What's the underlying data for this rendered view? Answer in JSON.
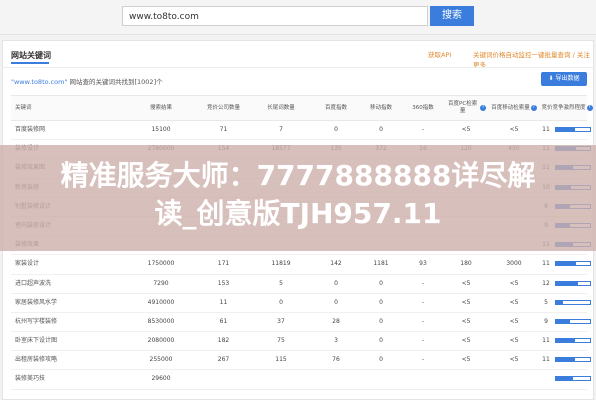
{
  "search": {
    "query": "www.to8to.com",
    "button": "搜索"
  },
  "card": {
    "title": "网站关键词",
    "link_api": "获取API",
    "link_promo": "关键词价格自动监控一键批量查询 / 关注更多",
    "summary_prefix": "\"www.to8to.com\"",
    "summary_rest": " 网站查的关键词共找到[1002]个",
    "export": "导出数据"
  },
  "headers": [
    "关键词",
    "搜索结果",
    "竞价公司数量",
    "长尾词数量",
    "百度指数",
    "移动指数",
    "360指数",
    "百度PC检索量",
    "百度移动检索量",
    "竞价竞争激烈程度"
  ],
  "rows": [
    {
      "kw": "百度装修网",
      "c2": "15100",
      "c3": "71",
      "c4": "7",
      "c5": "0",
      "c6": "0",
      "c7": "-",
      "c8": "<5",
      "c9": "<5",
      "c10": "11",
      "level": 0.55
    },
    {
      "kw": "装修设计",
      "c2": "2780000",
      "c3": "154",
      "c4": "18577",
      "c5": "135",
      "c6": "372",
      "c7": "16",
      "c8": "120",
      "c9": "450",
      "c10": "11",
      "level": 0.6
    },
    {
      "kw": "装修效果图",
      "c2": "",
      "c3": "",
      "c4": "",
      "c5": "",
      "c6": "",
      "c7": "",
      "c8": "",
      "c9": "",
      "c10": "11",
      "level": 0.5
    },
    {
      "kw": "新房装修",
      "c2": "",
      "c3": "",
      "c4": "",
      "c5": "",
      "c6": "",
      "c7": "",
      "c8": "",
      "c9": "",
      "c10": "10",
      "level": 0.45
    },
    {
      "kw": "别墅装修设计",
      "c2": "",
      "c3": "",
      "c4": "",
      "c5": "",
      "c6": "",
      "c7": "",
      "c8": "",
      "c9": "",
      "c10": "9",
      "level": 0.4
    },
    {
      "kw": "室内装修设计",
      "c2": "",
      "c3": "",
      "c4": "",
      "c5": "",
      "c6": "",
      "c7": "",
      "c8": "",
      "c9": "",
      "c10": "9",
      "level": 0.4
    },
    {
      "kw": "装修效果",
      "c2": "",
      "c3": "",
      "c4": "",
      "c5": "",
      "c6": "",
      "c7": "",
      "c8": "",
      "c9": "",
      "c10": "11",
      "level": 0.5
    },
    {
      "kw": "家装设计",
      "c2": "1750000",
      "c3": "171",
      "c4": "11819",
      "c5": "142",
      "c6": "1181",
      "c7": "93",
      "c8": "180",
      "c9": "3000",
      "c10": "11",
      "level": 0.6
    },
    {
      "kw": "进口超声波洗",
      "c2": "7290",
      "c3": "153",
      "c4": "5",
      "c5": "0",
      "c6": "0",
      "c7": "-",
      "c8": "<5",
      "c9": "<5",
      "c10": "12",
      "level": 0.65
    },
    {
      "kw": "家居装修风水学",
      "c2": "4910000",
      "c3": "11",
      "c4": "0",
      "c5": "0",
      "c6": "0",
      "c7": "-",
      "c8": "<5",
      "c9": "<5",
      "c10": "5",
      "level": 0.2
    },
    {
      "kw": "杭州写字楼装修",
      "c2": "8530000",
      "c3": "61",
      "c4": "37",
      "c5": "28",
      "c6": "0",
      "c7": "-",
      "c8": "<5",
      "c9": "<5",
      "c10": "9",
      "level": 0.4
    },
    {
      "kw": "卧室床下设计图",
      "c2": "2080000",
      "c3": "182",
      "c4": "75",
      "c5": "3",
      "c6": "0",
      "c7": "-",
      "c8": "<5",
      "c9": "<5",
      "c10": "11",
      "level": 0.55
    },
    {
      "kw": "出租房装修攻略",
      "c2": "255000",
      "c3": "267",
      "c4": "115",
      "c5": "76",
      "c6": "0",
      "c7": "-",
      "c8": "<5",
      "c9": "<5",
      "c10": "11",
      "level": 0.55
    },
    {
      "kw": "装修美巧技",
      "c2": "29600",
      "c3": "",
      "c4": "",
      "c5": "",
      "c6": "",
      "c7": "",
      "c8": "",
      "c9": "",
      "c10": "",
      "level": 0.5
    }
  ],
  "overlay": {
    "line1": "精准服务大师：7777888888详尽解",
    "line2": "读_创意版TJH957.11"
  },
  "colors": {
    "accent": "#3b7ddd",
    "link": "#e08a2e",
    "overlay": "#cdafaa"
  }
}
